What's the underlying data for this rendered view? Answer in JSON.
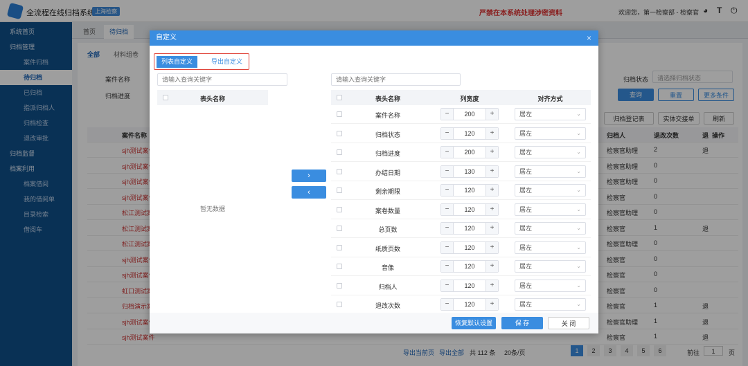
{
  "topbar": {
    "app_title": "全流程在线归档系统",
    "tag": "上海检察",
    "warning": "严禁在本系统处理涉密资料",
    "welcome": "欢迎您，第一检察部 - 检察官"
  },
  "sidebar": {
    "items": [
      {
        "label": "系统首页",
        "sub": false
      },
      {
        "label": "归档管理",
        "sub": false
      },
      {
        "label": "案件归档",
        "sub": true
      },
      {
        "label": "待归档",
        "sub": true,
        "active": true
      },
      {
        "label": "已归档",
        "sub": true
      },
      {
        "label": "指派归档人",
        "sub": true
      },
      {
        "label": "归档检查",
        "sub": true
      },
      {
        "label": "退改审批",
        "sub": true
      },
      {
        "label": "归档监督",
        "sub": false
      },
      {
        "label": "档案利用",
        "sub": false
      },
      {
        "label": "档案借阅",
        "sub": true
      },
      {
        "label": "我的借阅单",
        "sub": true
      },
      {
        "label": "目录检索",
        "sub": true
      },
      {
        "label": "借阅车",
        "sub": true
      }
    ]
  },
  "tabs": [
    "首页",
    "待归档"
  ],
  "subtabs": [
    "全部",
    "材料组卷"
  ],
  "filters": {
    "case_name": "案件名称",
    "progress": "归档进度",
    "status": "归档状态",
    "status_placeholder": "请选择归档状态"
  },
  "actions": {
    "query": "查询",
    "reset": "重置",
    "more": "更多条件",
    "refresh": "刷新",
    "log": "归档登记表",
    "export": "实体交接单"
  },
  "table": {
    "cols": [
      "案件名称",
      "归档人",
      "退改次数",
      "退",
      "操作"
    ],
    "rows": [
      {
        "name": "sjh测试案件",
        "person": "检察官助理",
        "count": "2",
        "ret": "退"
      },
      {
        "name": "sjh测试案件",
        "person": "检察官助理",
        "count": "0",
        "ret": ""
      },
      {
        "name": "sjh测试案件",
        "person": "检察官助理",
        "count": "0",
        "ret": ""
      },
      {
        "name": "sjh测试案件",
        "person": "检察官",
        "count": "0",
        "ret": ""
      },
      {
        "name": "松江测试案件",
        "person": "检察官助理",
        "count": "0",
        "ret": ""
      },
      {
        "name": "松江测试案件",
        "person": "检察官",
        "count": "1",
        "ret": "退"
      },
      {
        "name": "松江测试案件",
        "person": "检察官助理",
        "count": "0",
        "ret": ""
      },
      {
        "name": "sjh测试案件",
        "person": "检察官",
        "count": "0",
        "ret": ""
      },
      {
        "name": "sjh测试案件",
        "person": "检察官",
        "count": "0",
        "ret": ""
      },
      {
        "name": "虹口测试案件",
        "person": "检察官",
        "count": "0",
        "ret": ""
      },
      {
        "name": "归档演示案件",
        "person": "检察官",
        "count": "1",
        "ret": "退"
      },
      {
        "name": "sjh测试案件",
        "person": "检察官助理",
        "count": "1",
        "ret": "退"
      },
      {
        "name": "sjh测试案件",
        "person": "检察官",
        "count": "1",
        "ret": "退"
      }
    ]
  },
  "pagination": {
    "export_page": "导出当前页",
    "export_all": "导出全部",
    "total": "共 112 条",
    "per_page": "20条/页",
    "pages": [
      "1",
      "2",
      "3",
      "4",
      "5",
      "6"
    ],
    "goto": "前往",
    "goto_val": "1",
    "page_suffix": "页"
  },
  "dialog": {
    "title": "自定义",
    "close": "×",
    "tab_list": "列表自定义",
    "tab_export": "导出自定义",
    "left_search_placeholder": "请输入查询关键字",
    "right_search_placeholder": "请输入查询关键字",
    "left_header": "表头名称",
    "empty": "暂无数据",
    "move_right": "›",
    "move_left": "‹",
    "right_headers": {
      "name": "表头名称",
      "width": "列宽度",
      "align": "对齐方式"
    },
    "columns": [
      {
        "name": "案件名称",
        "width": "200",
        "align": "居左"
      },
      {
        "name": "归档状态",
        "width": "120",
        "align": "居左"
      },
      {
        "name": "归档进度",
        "width": "200",
        "align": "居左"
      },
      {
        "name": "办结日期",
        "width": "130",
        "align": "居左"
      },
      {
        "name": "剩余期限",
        "width": "120",
        "align": "居左"
      },
      {
        "name": "案卷数量",
        "width": "120",
        "align": "居左"
      },
      {
        "name": "总页数",
        "width": "120",
        "align": "居左"
      },
      {
        "name": "纸质页数",
        "width": "120",
        "align": "居左"
      },
      {
        "name": "音像",
        "width": "120",
        "align": "居左"
      },
      {
        "name": "归档人",
        "width": "120",
        "align": "居左"
      },
      {
        "name": "退改次数",
        "width": "120",
        "align": "居左"
      }
    ],
    "footer": {
      "restore": "恢复默认设置",
      "save": "保 存",
      "close": "关 闭"
    }
  },
  "colors": {
    "primary": "#3a8de0",
    "sidebar": "#0f4f8a",
    "warning": "#d33",
    "highlight": "#e0443a"
  }
}
